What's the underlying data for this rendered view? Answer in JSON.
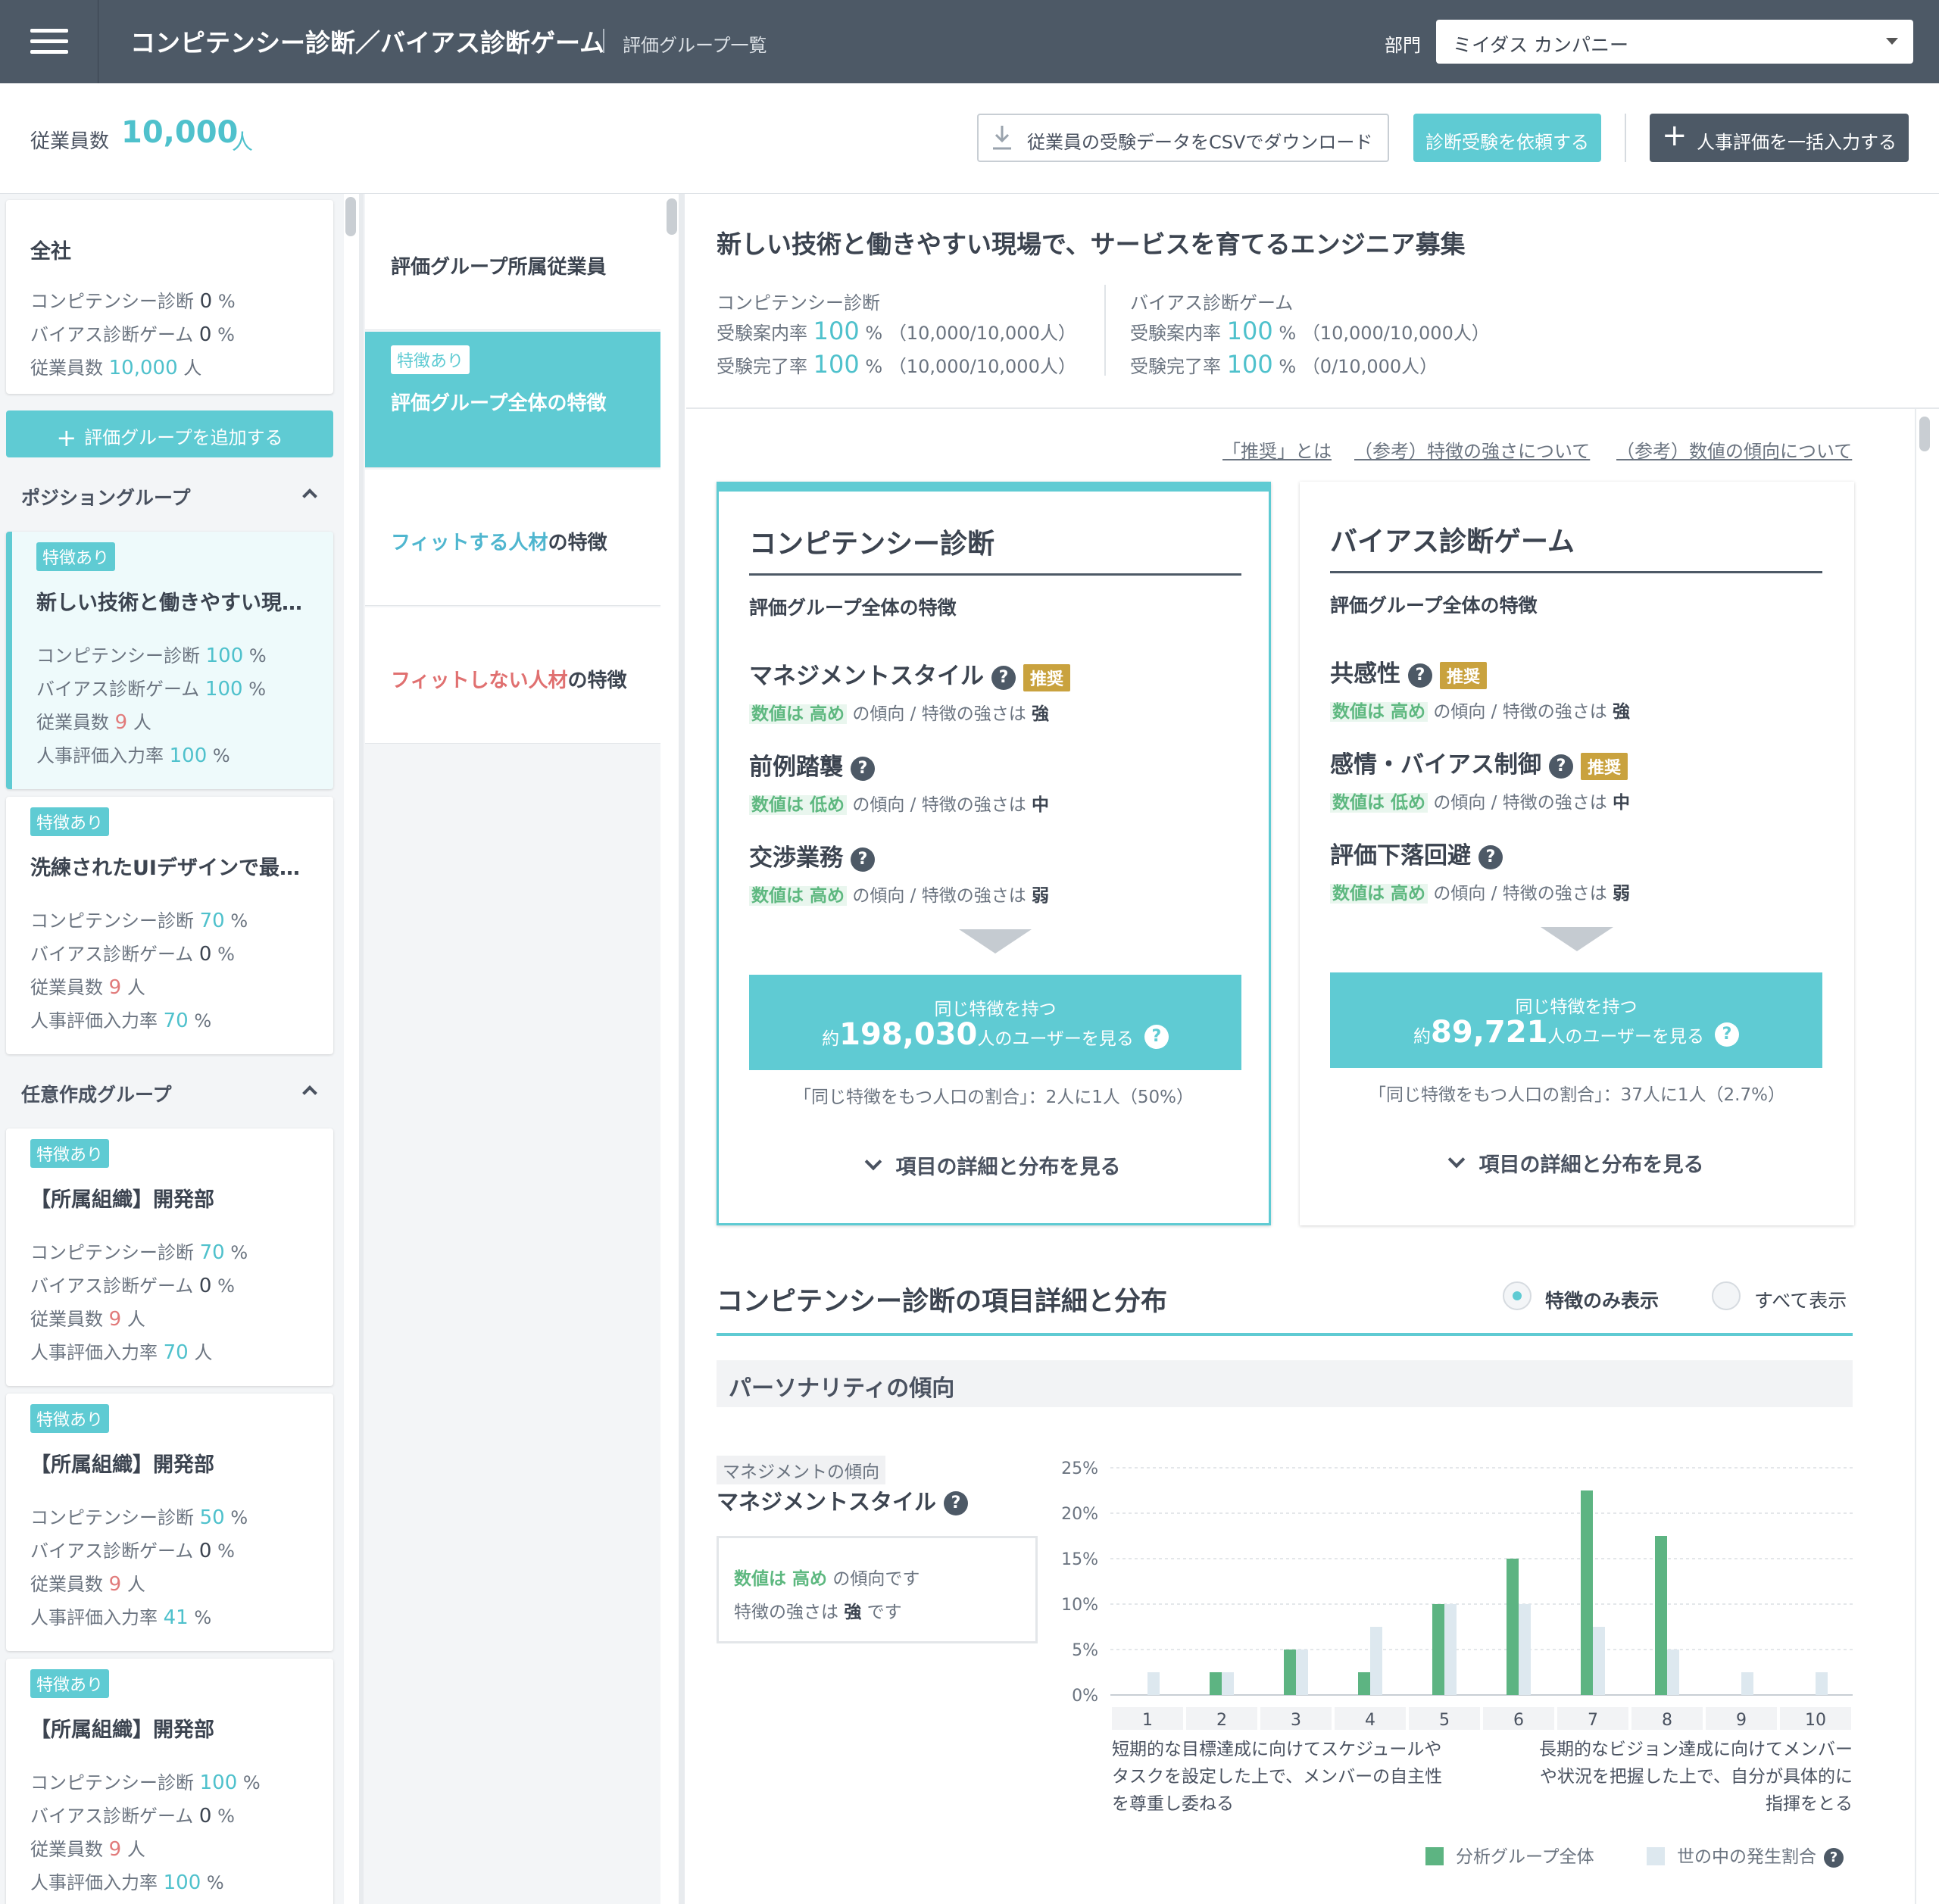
{
  "header": {
    "title": "コンピテンシー診断／バイアス診断ゲーム",
    "subtitle": "評価グループ一覧",
    "dept_label": "部門",
    "dept_value": "ミイダス カンパニー"
  },
  "toolbar": {
    "employee_label": "従業員数",
    "employee_count": "10,000",
    "employee_unit": "人",
    "csv_button": "従業員の受験データをCSVでダウンロード",
    "request_button": "診断受験を依頼する",
    "bulk_button": "人事評価を一括入力する"
  },
  "sidebar": {
    "company": {
      "title": "全社",
      "rows": [
        {
          "label": "コンピテンシー診断",
          "value": "0",
          "unit": "%"
        },
        {
          "label": "バイアス診断ゲーム",
          "value": "0",
          "unit": "%"
        },
        {
          "label": "従業員数",
          "value": "10,000",
          "unit": "人"
        }
      ]
    },
    "add_group": "評価グループを追加する",
    "position_group_label": "ポジショングループ",
    "custom_group_label": "任意作成グループ",
    "position_groups": [
      {
        "tag": "特徴あり",
        "title": "新しい技術と働きやすい現…",
        "rows": [
          {
            "label": "コンピテンシー診断",
            "value": "100",
            "unit": "%"
          },
          {
            "label": "バイアス診断ゲーム",
            "value": "100",
            "unit": "%"
          },
          {
            "label": "従業員数",
            "value": "9",
            "unit": "人"
          },
          {
            "label": "人事評価入力率",
            "value": "100",
            "unit": "%"
          }
        ]
      },
      {
        "tag": "特徴あり",
        "title": "洗練されたUIデザインで最…",
        "rows": [
          {
            "label": "コンピテンシー診断",
            "value": "70",
            "unit": "%"
          },
          {
            "label": "バイアス診断ゲーム",
            "value": "0",
            "unit": "%"
          },
          {
            "label": "従業員数",
            "value": "9",
            "unit": "人"
          },
          {
            "label": "人事評価入力率",
            "value": "70",
            "unit": "%"
          }
        ]
      }
    ],
    "custom_groups": [
      {
        "tag": "特徴あり",
        "title": "【所属組織】開発部",
        "rows": [
          {
            "label": "コンピテンシー診断",
            "value": "70",
            "unit": "%"
          },
          {
            "label": "バイアス診断ゲーム",
            "value": "0",
            "unit": "%"
          },
          {
            "label": "従業員数",
            "value": "9",
            "unit": "人"
          },
          {
            "label": "人事評価入力率",
            "value": "70",
            "unit": "人"
          }
        ]
      },
      {
        "tag": "特徴あり",
        "title": "【所属組織】開発部",
        "rows": [
          {
            "label": "コンピテンシー診断",
            "value": "50",
            "unit": "%"
          },
          {
            "label": "バイアス診断ゲーム",
            "value": "0",
            "unit": "%"
          },
          {
            "label": "従業員数",
            "value": "9",
            "unit": "人"
          },
          {
            "label": "人事評価入力率",
            "value": "41",
            "unit": "%"
          }
        ]
      },
      {
        "tag": "特徴あり",
        "title": "【所属組織】開発部",
        "rows": [
          {
            "label": "コンピテンシー診断",
            "value": "100",
            "unit": "%"
          },
          {
            "label": "バイアス診断ゲーム",
            "value": "0",
            "unit": "%"
          },
          {
            "label": "従業員数",
            "value": "9",
            "unit": "人"
          },
          {
            "label": "人事評価入力率",
            "value": "100",
            "unit": "%"
          }
        ]
      }
    ]
  },
  "midnav": {
    "members": "評価グループ所属従業員",
    "overall_tag": "特徴あり",
    "overall": "評価グループ全体の特徴",
    "fit_colored": "フィットする人材",
    "fit_suffix": "の特徴",
    "unfit_colored": "フィットしない人材",
    "unfit_suffix": "の特徴"
  },
  "main": {
    "group_title": "新しい技術と働きやすい現場で、サービスを育てるエンジニア募集",
    "stats": [
      {
        "name": "コンピテンシー診断",
        "invite_label": "受験案内率",
        "invite_value": "100",
        "invite_unit": "%",
        "invite_detail": "（10,000/10,000人）",
        "complete_label": "受験完了率",
        "complete_value": "100",
        "complete_unit": "%",
        "complete_detail": "（10,000/10,000人）"
      },
      {
        "name": "バイアス診断ゲーム",
        "invite_label": "受験案内率",
        "invite_value": "100",
        "invite_unit": "%",
        "invite_detail": "（10,000/10,000人）",
        "complete_label": "受験完了率",
        "complete_value": "100",
        "complete_unit": "%",
        "complete_detail": "（0/10,000人）"
      }
    ],
    "links": [
      "「推奨」とは",
      "（参考）特徴の強さについて",
      "（参考）数値の傾向について"
    ],
    "cards": [
      {
        "title": "コンピテンシー診断",
        "subtitle": "評価グループ全体の特徴",
        "traits": [
          {
            "name": "マネジメントスタイル",
            "recommended": "推奨",
            "hl": "数値は 高め",
            "mid": " の傾向 / 特徴の強さは ",
            "strength": "強"
          },
          {
            "name": "前例踏襲",
            "recommended": "",
            "hl": "数値は 低め",
            "mid": " の傾向 / 特徴の強さは ",
            "strength": "中"
          },
          {
            "name": "交渉業務",
            "recommended": "",
            "hl": "数値は 高め",
            "mid": " の傾向 / 特徴の強さは ",
            "strength": "弱"
          }
        ],
        "btn_line1": "同じ特徴を持つ",
        "btn_prefix": "約",
        "btn_count": "198,030",
        "btn_suffix": "人のユーザーを見る",
        "ratio": "「同じ特徴をもつ人口の割合」：2人に1人（50%）",
        "detail": "項目の詳細と分布を見る"
      },
      {
        "title": "バイアス診断ゲーム",
        "subtitle": "評価グループ全体の特徴",
        "traits": [
          {
            "name": "共感性",
            "recommended": "推奨",
            "hl": "数値は 高め",
            "mid": " の傾向 / 特徴の強さは ",
            "strength": "強"
          },
          {
            "name": "感情・バイアス制御",
            "recommended": "推奨",
            "hl": "数値は 低め",
            "mid": " の傾向 / 特徴の強さは ",
            "strength": "中"
          },
          {
            "name": "評価下落回避",
            "recommended": "",
            "hl": "数値は 高め",
            "mid": " の傾向 / 特徴の強さは ",
            "strength": "弱"
          }
        ],
        "btn_line1": "同じ特徴を持つ",
        "btn_prefix": "約",
        "btn_count": "89,721",
        "btn_suffix": "人のユーザーを見る",
        "ratio": "「同じ特徴をもつ人口の割合」：37人に1人（2.7%）",
        "detail": "項目の詳細と分布を見る"
      }
    ],
    "distribution": {
      "title": "コンピテンシー診断の項目詳細と分布",
      "radio_on": "特徴のみ表示",
      "radio_off": "すべて表示",
      "section": "パーソナリティの傾向",
      "metric_tag": "マネジメントの傾向",
      "metric_name": "マネジメントスタイル",
      "box_hl": "数値は 高め",
      "box_line1_suffix": " の傾向です",
      "box_line2_prefix": "特徴の強さは ",
      "box_strength": "強",
      "box_line2_suffix": " です",
      "left_note": "短期的な目標達成に向けてスケジュールやタスクを設定した上で、メンバーの自主性を尊重し委ねる",
      "right_note": "長期的なビジョン達成に向けてメンバーや状況を把握した上で、自分が具体的に指揮をとる",
      "legend_group": "分析グループ全体",
      "legend_world": "世の中の発生割合"
    }
  },
  "colors": {
    "accent": "#5fcbd3",
    "header": "#4d5966",
    "group_bar": "#5db482",
    "world_bar": "#dde8ef",
    "recommended": "#c9a23e",
    "fit_text": "#4fb6cf",
    "unfit_text": "#e07070"
  },
  "chart_data": {
    "type": "bar",
    "categories": [
      "1",
      "2",
      "3",
      "4",
      "5",
      "6",
      "7",
      "8",
      "9",
      "10"
    ],
    "ylim": [
      0,
      25
    ],
    "yticks": [
      "0%",
      "5%",
      "10%",
      "15%",
      "20%",
      "25%"
    ],
    "grid": true,
    "series": [
      {
        "name": "分析グループ全体",
        "values": [
          0,
          2.5,
          5,
          2.5,
          10,
          15,
          22.5,
          17.5,
          0,
          0
        ]
      },
      {
        "name": "世の中の発生割合",
        "values": [
          2.5,
          2.5,
          5,
          7.5,
          10,
          10,
          7.5,
          5,
          2.5,
          2.5
        ]
      }
    ]
  }
}
